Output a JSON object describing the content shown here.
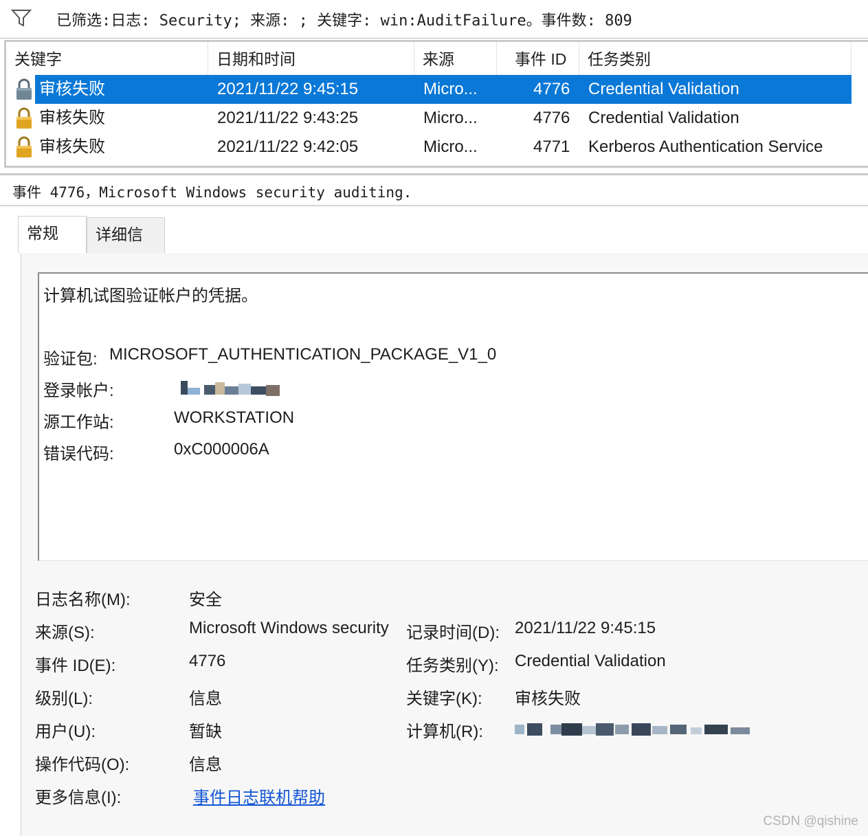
{
  "filter_bar": {
    "icon": "filter-icon",
    "text": "已筛选:日志: Security; 来源: ; 关键字: win:AuditFailure。事件数: 809"
  },
  "event_list": {
    "columns": [
      "关键字",
      "日期和时间",
      "来源",
      "事件 ID",
      "任务类别"
    ],
    "rows": [
      {
        "keyword": "审核失败",
        "datetime": "2021/11/22 9:45:15",
        "source": "Micro...",
        "event_id": "4776",
        "task": "Credential Validation",
        "selected": true
      },
      {
        "keyword": "审核失败",
        "datetime": "2021/11/22 9:43:25",
        "source": "Micro...",
        "event_id": "4776",
        "task": "Credential Validation",
        "selected": false
      },
      {
        "keyword": "审核失败",
        "datetime": "2021/11/22 9:42:05",
        "source": "Micro...",
        "event_id": "4771",
        "task": "Kerberos Authentication Service",
        "selected": false
      }
    ],
    "row_icon": "lock-icon",
    "selected_color": "#0a78d7"
  },
  "details": {
    "title": "事件 4776，Microsoft Windows security auditing.",
    "tabs": [
      "常规",
      "详细信息"
    ],
    "active_tab": "常规",
    "description": {
      "summary": "计算机试图验证帐户的凭据。",
      "package_label": "验证包:",
      "package_value": "MICROSOFT_AUTHENTICATION_PACKAGE_V1_0",
      "logon_account_label": "登录帐户:",
      "workstation_label": "源工作站:",
      "workstation_value": "WORKSTATION",
      "error_label": "错误代码:",
      "error_value": "0xC000006A"
    },
    "properties": {
      "log_name_label": "日志名称(M):",
      "log_name_value": "安全",
      "source_label": "来源(S):",
      "source_value": "Microsoft Windows security auditing.",
      "logged_label": "记录时间(D):",
      "logged_value": "2021/11/22 9:45:15",
      "event_id_label": "事件 ID(E):",
      "event_id_value": "4776",
      "task_label": "任务类别(Y):",
      "task_value": "Credential Validation",
      "level_label": "级别(L):",
      "level_value": "信息",
      "keywords_label": "关键字(K):",
      "keywords_value": "审核失败",
      "user_label": "用户(U):",
      "user_value": "暂缺",
      "computer_label": "计算机(R):",
      "opcode_label": "操作代码(O):",
      "opcode_value": "信息",
      "more_info_label": "更多信息(I):",
      "more_info_link": "事件日志联机帮助",
      "link_color": "#1356d6"
    }
  },
  "watermark": "CSDN @qishine"
}
